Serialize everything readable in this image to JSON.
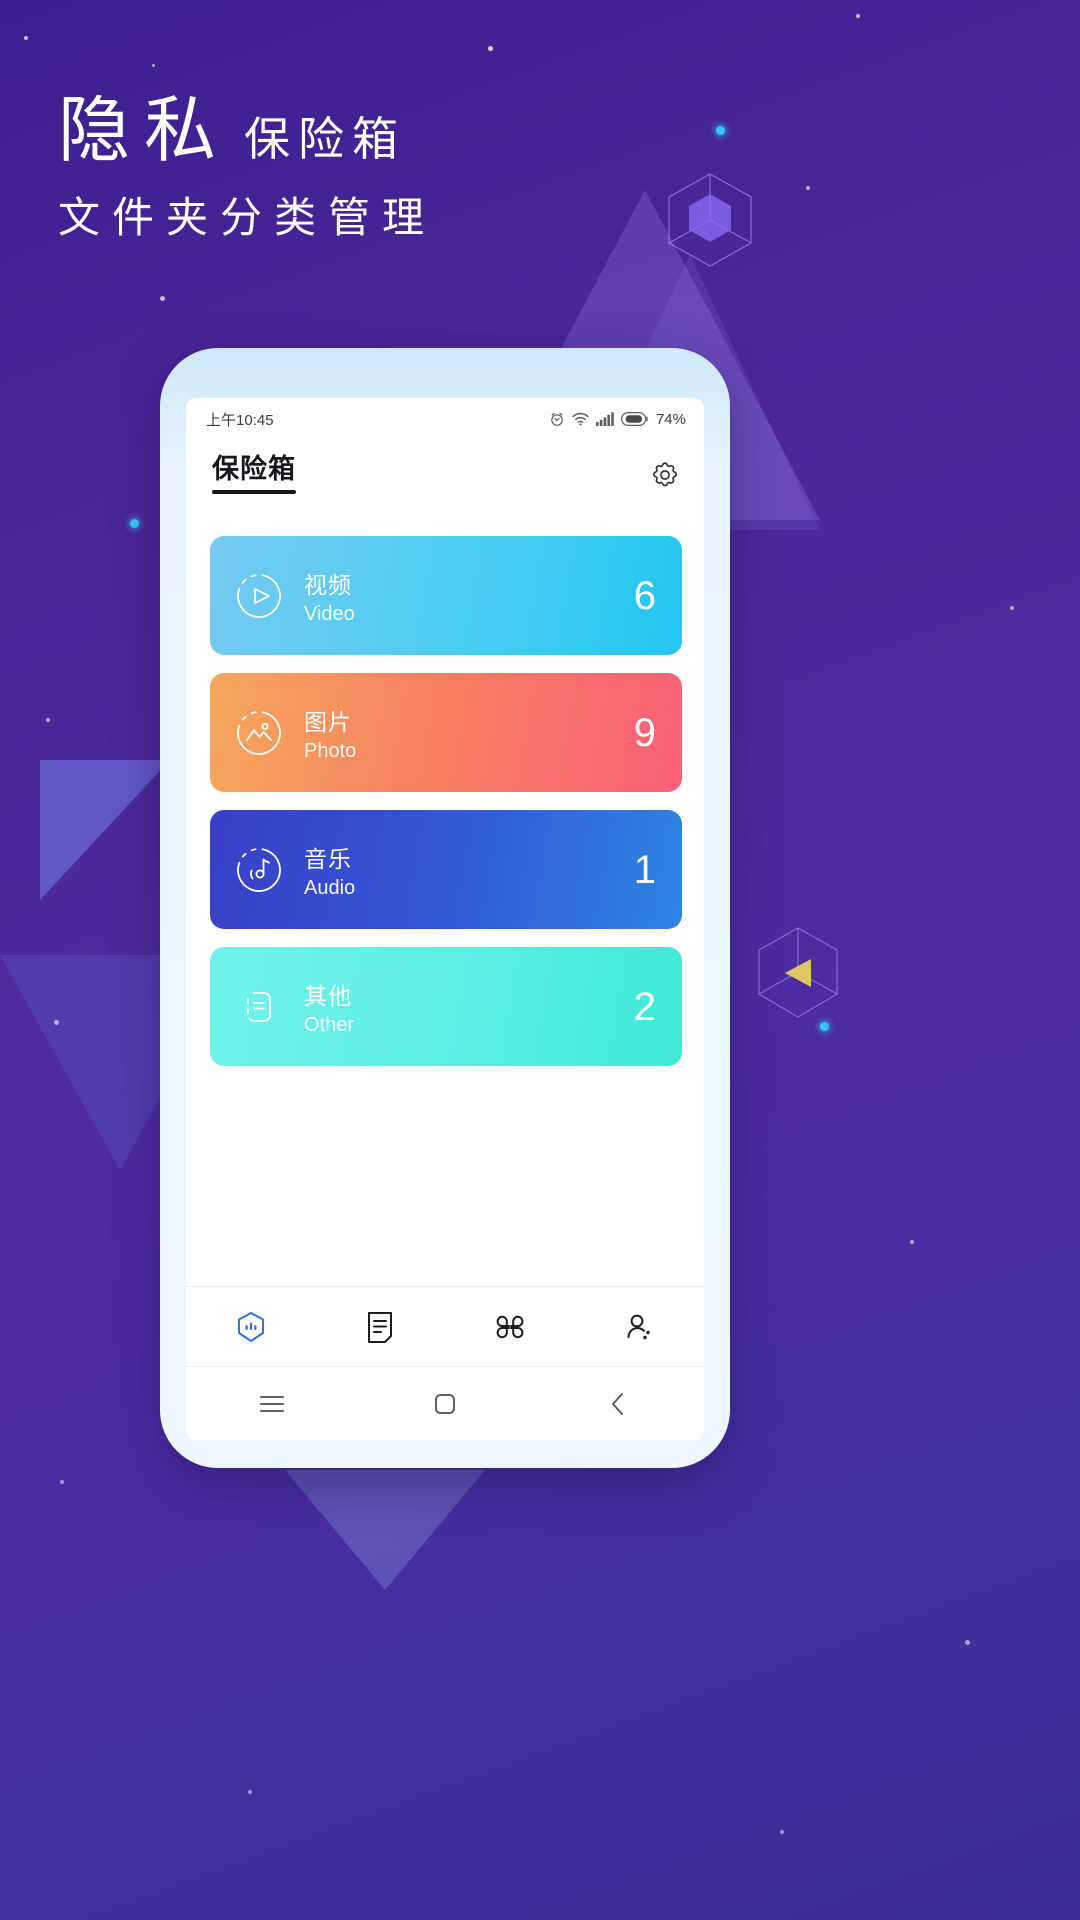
{
  "poster": {
    "headline_main": "隐私",
    "headline_sub": "保险箱",
    "subheadline": "文件夹分类管理",
    "background_color": "#4a2596",
    "accent_color": "#35c8f4"
  },
  "phone": {
    "statusbar": {
      "time": "上午10:45",
      "battery_percent": "74%",
      "icons": [
        "alarm-icon",
        "wifi-icon",
        "signal-icon",
        "battery-icon"
      ]
    },
    "header": {
      "title": "保险箱",
      "settings_icon": "gear-icon"
    },
    "cards": [
      {
        "name_cn": "视频",
        "name_en": "Video",
        "count": "6",
        "icon": "video-play-icon",
        "color_start": "#6fc8f0",
        "color_end": "#2bc6f0"
      },
      {
        "name_cn": "图片",
        "name_en": "Photo",
        "count": "9",
        "icon": "photo-mountain-icon",
        "color_start": "#f5a55f",
        "color_end": "#f95b7a"
      },
      {
        "name_cn": "音乐",
        "name_en": "Audio",
        "count": "1",
        "icon": "music-note-icon",
        "color_start": "#3b42c4",
        "color_end": "#2f7fe0"
      },
      {
        "name_cn": "其他",
        "name_en": "Other",
        "count": "2",
        "icon": "document-lines-icon",
        "color_start": "#6ff0ea",
        "color_end": "#45e8da"
      }
    ],
    "tabbar": {
      "active_color": "#2f73e8",
      "inactive_color": "#1b1d21",
      "items": [
        {
          "icon": "shield-vault-icon",
          "active": true
        },
        {
          "icon": "document-icon",
          "active": false
        },
        {
          "icon": "grid-apps-icon",
          "active": false
        },
        {
          "icon": "person-icon",
          "active": false
        }
      ]
    },
    "navbar": {
      "items": [
        {
          "icon": "menu-icon"
        },
        {
          "icon": "home-square-icon"
        },
        {
          "icon": "back-chevron-icon"
        }
      ]
    }
  }
}
